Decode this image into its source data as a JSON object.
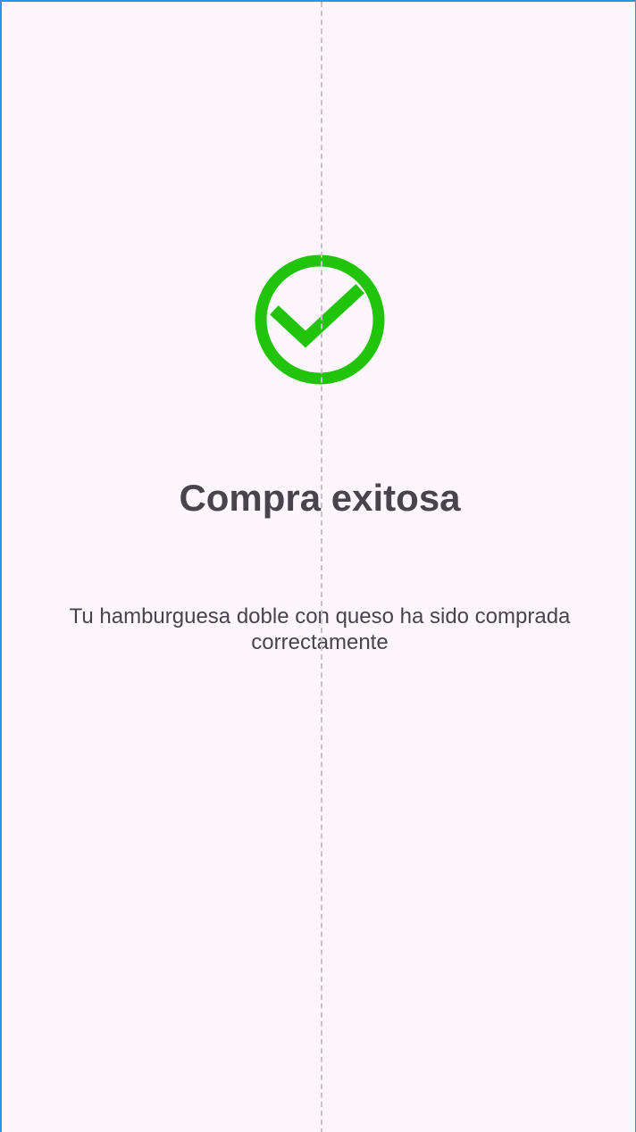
{
  "screen": {
    "icon": "check-circle-icon",
    "title": "Compra exitosa",
    "message_lines": [
      "Tu hamburguesa doble con queso ha sido comprada",
      "correctamente"
    ]
  },
  "colors": {
    "background": "#fdf6fd",
    "success_green": "#22c30b",
    "text": "#48444c",
    "frame_border": "#2196f3",
    "guide_line": "#c7c3c9"
  }
}
